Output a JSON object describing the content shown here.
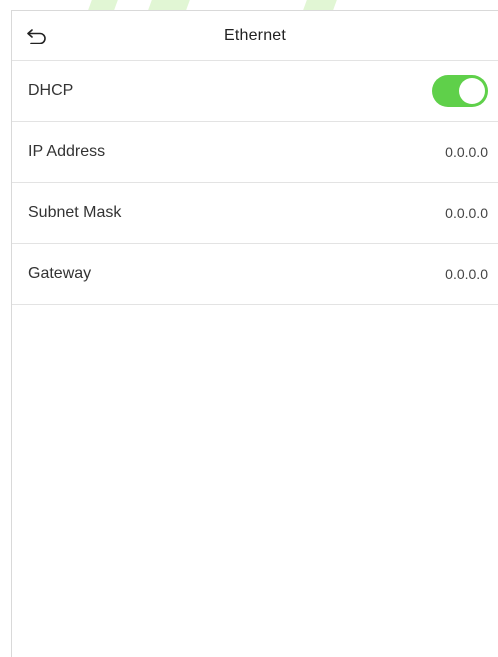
{
  "header": {
    "title": "Ethernet",
    "back_icon": "back-arrow-icon"
  },
  "settings": [
    {
      "label": "DHCP",
      "type": "toggle",
      "enabled": true
    },
    {
      "label": "IP Address",
      "value": "0.0.0.0"
    },
    {
      "label": "Subnet Mask",
      "value": "0.0.0.0"
    },
    {
      "label": "Gateway",
      "value": "0.0.0.0"
    }
  ],
  "colors": {
    "toggle_on": "#5fd04a",
    "divider": "#e3e3e3"
  }
}
